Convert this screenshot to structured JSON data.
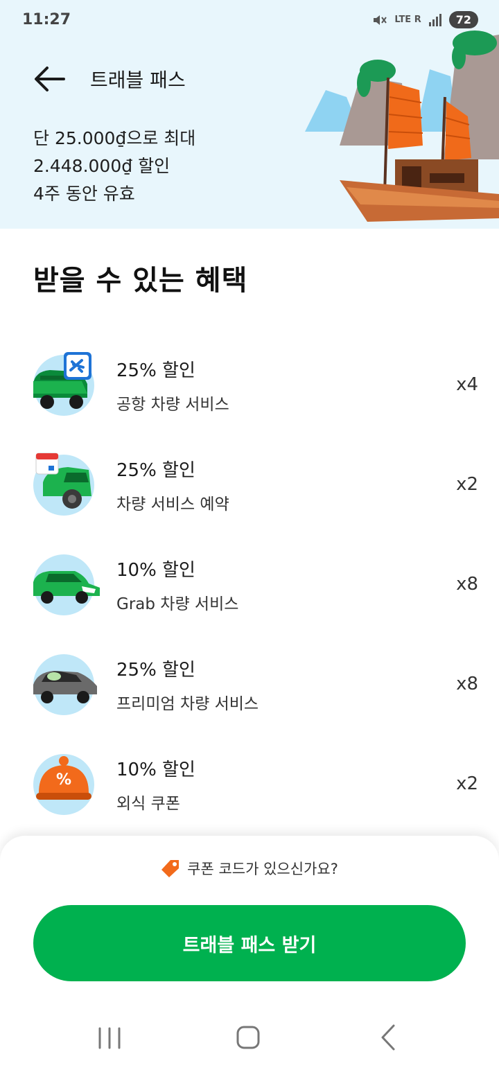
{
  "status_bar": {
    "time": "11:27",
    "network": "LTE R",
    "battery": "72"
  },
  "header": {
    "title": "트래블 패스"
  },
  "promo": {
    "line1": "단 25.000₫으로 최대",
    "line2": "2.448.000₫ 할인",
    "line3": "4주 동안 유효"
  },
  "benefits": {
    "title": "받을 수 있는 혜택",
    "items": [
      {
        "discount": "25% 할인",
        "service": "공항 차량 서비스",
        "count": "x4",
        "icon": "airport-car-icon"
      },
      {
        "discount": "25% 할인",
        "service": "차량 서비스 예약",
        "count": "x2",
        "icon": "scheduled-car-icon"
      },
      {
        "discount": "10% 할인",
        "service": "Grab 차량 서비스",
        "count": "x8",
        "icon": "grab-car-icon"
      },
      {
        "discount": "25% 할인",
        "service": "프리미엄 차량 서비스",
        "count": "x8",
        "icon": "premium-car-icon"
      },
      {
        "discount": "10% 할인",
        "service": "외식 쿠폰",
        "count": "x2",
        "icon": "dining-coupon-icon"
      }
    ]
  },
  "bottom": {
    "coupon_prompt": "쿠폰 코드가 있으신가요?",
    "cta_label": "트래블 패스 받기"
  },
  "colors": {
    "brand_green": "#00b14f",
    "hero_bg": "#e8f6fc",
    "icon_bg": "#bfe7f8"
  }
}
